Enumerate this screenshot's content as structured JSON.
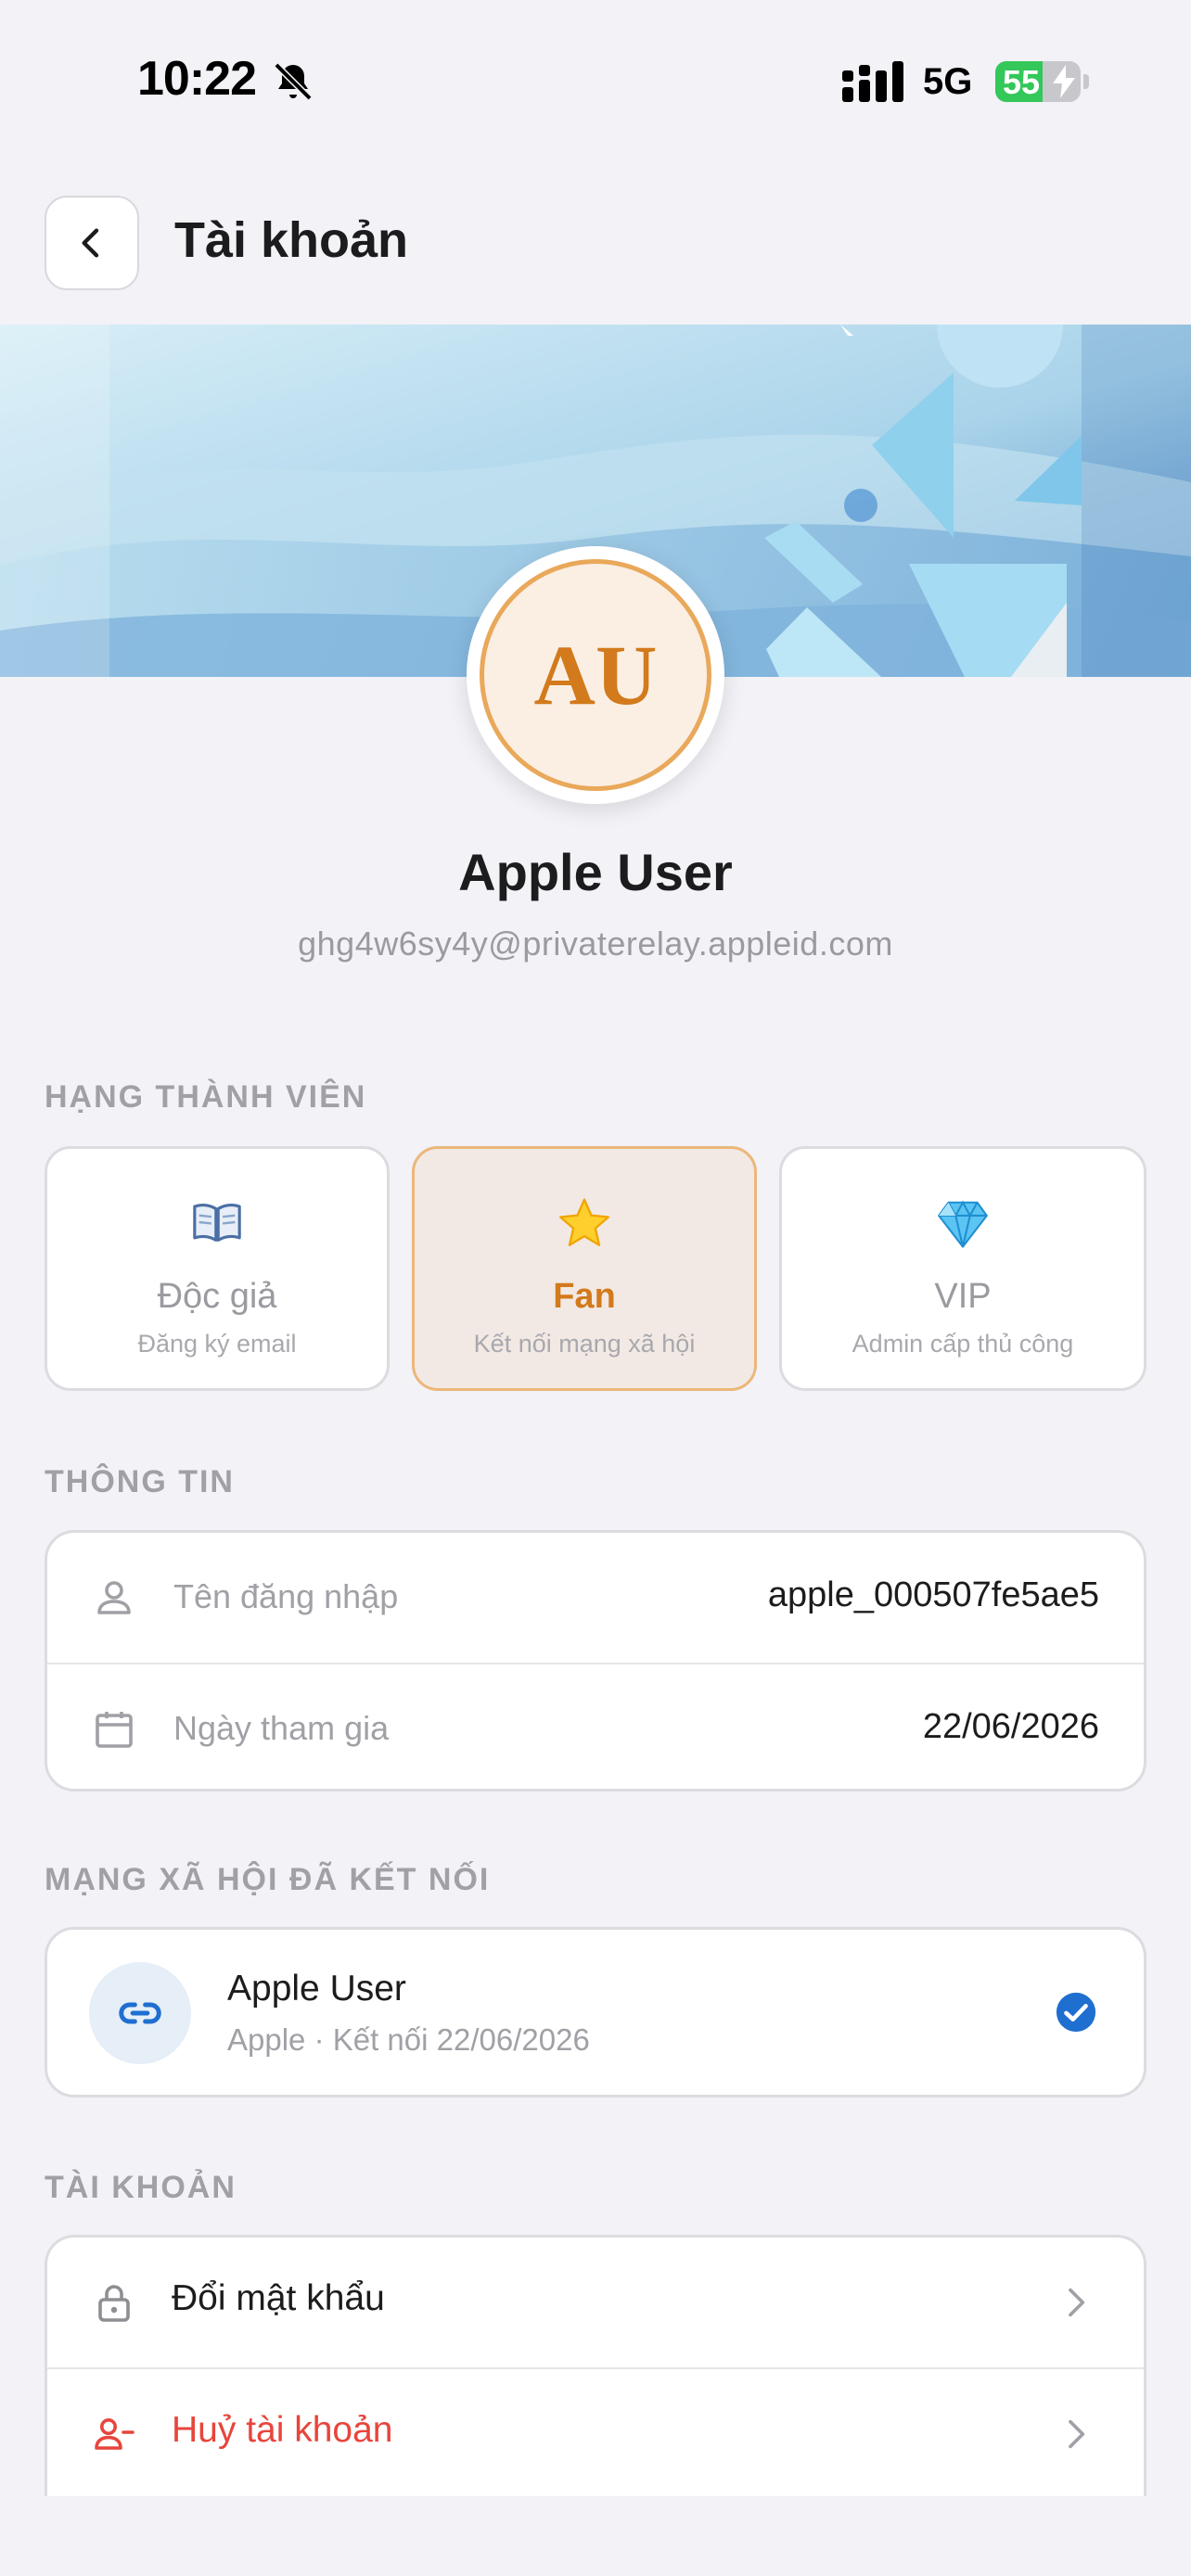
{
  "status_bar": {
    "time": "10:22",
    "network": "5G",
    "battery_percent": "55",
    "battery_level": 0.55
  },
  "header": {
    "title": "Tài khoản",
    "back_icon": "chevron-left-icon"
  },
  "profile": {
    "initials": "AU",
    "name": "Apple User",
    "email": "ghg4w6sy4y@privaterelay.appleid.com"
  },
  "membership": {
    "section_label": "HẠNG THÀNH VIÊN",
    "tiers": [
      {
        "icon": "📖",
        "icon_name": "book-icon",
        "name": "Độc giả",
        "description": "Đăng ký email",
        "active": false
      },
      {
        "icon": "⭐",
        "icon_name": "star-icon",
        "name": "Fan",
        "description": "Kết nối mạng xã hội",
        "active": true
      },
      {
        "icon": "💎",
        "icon_name": "diamond-icon",
        "name": "VIP",
        "description": "Admin cấp thủ công",
        "active": false
      }
    ]
  },
  "info": {
    "section_label": "THÔNG TIN",
    "rows": [
      {
        "icon": "user-icon",
        "label": "Tên đăng nhập",
        "value": "apple_000507fe5ae5"
      },
      {
        "icon": "calendar-icon",
        "label": "Ngày tham gia",
        "value": "22/06/2026"
      }
    ]
  },
  "social": {
    "section_label": "MẠNG XÃ HỘI ĐÃ KẾT NỐI",
    "accounts": [
      {
        "icon": "link-icon",
        "name": "Apple User",
        "meta": "Apple · Kết nối 22/06/2026",
        "connected": true
      }
    ]
  },
  "account": {
    "section_label": "TÀI KHOẢN",
    "actions": [
      {
        "icon": "lock-icon",
        "label": "Đổi mật khẩu",
        "danger": false
      },
      {
        "icon": "user-remove-icon",
        "label": "Huỷ tài khoản",
        "danger": true
      }
    ]
  },
  "colors": {
    "background": "#f2f2f7",
    "accent_orange": "#d27a1c",
    "danger_red": "#e8453c",
    "link_blue": "#1f6fd1",
    "battery_green": "#34c759"
  }
}
